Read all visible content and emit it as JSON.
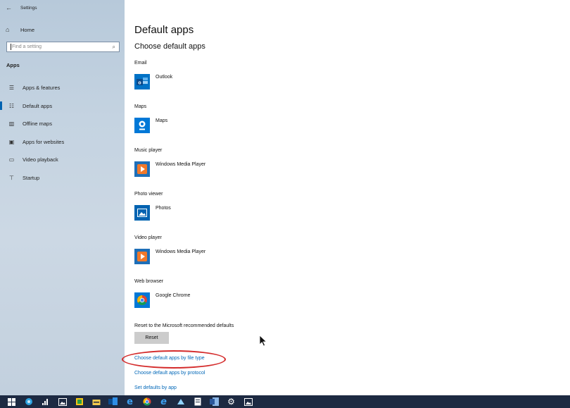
{
  "window": {
    "title": "Settings",
    "back_icon": "back-arrow-icon"
  },
  "sidebar": {
    "home_label": "Home",
    "search_placeholder": "Find a setting",
    "section_heading": "Apps",
    "items": [
      {
        "label": "Apps & features",
        "icon": "apps-features-icon",
        "active": false
      },
      {
        "label": "Default apps",
        "icon": "default-apps-icon",
        "active": true
      },
      {
        "label": "Offline maps",
        "icon": "offline-maps-icon",
        "active": false
      },
      {
        "label": "Apps for websites",
        "icon": "apps-for-websites-icon",
        "active": false
      },
      {
        "label": "Video playback",
        "icon": "video-playback-icon",
        "active": false
      },
      {
        "label": "Startup",
        "icon": "startup-icon",
        "active": false
      }
    ]
  },
  "main": {
    "title": "Default apps",
    "subtitle": "Choose default apps",
    "categories": [
      {
        "label": "Email",
        "app": "Outlook",
        "icon": "outlook-icon"
      },
      {
        "label": "Maps",
        "app": "Maps",
        "icon": "maps-icon"
      },
      {
        "label": "Music player",
        "app": "Windows Media Player",
        "icon": "windows-media-player-icon"
      },
      {
        "label": "Photo viewer",
        "app": "Photos",
        "icon": "photos-icon"
      },
      {
        "label": "Video player",
        "app": "Windows Media Player",
        "icon": "windows-media-player-icon"
      },
      {
        "label": "Web browser",
        "app": "Google Chrome",
        "icon": "google-chrome-icon"
      }
    ],
    "reset_label": "Reset to the Microsoft recommended defaults",
    "reset_button": "Reset",
    "links": [
      "Choose default apps by file type",
      "Choose default apps by protocol",
      "Set defaults by app"
    ]
  },
  "colors": {
    "accent": "#0063b1",
    "link": "#0067b8",
    "annotation": "#d42b2b",
    "taskbar": "#1d2a42"
  }
}
